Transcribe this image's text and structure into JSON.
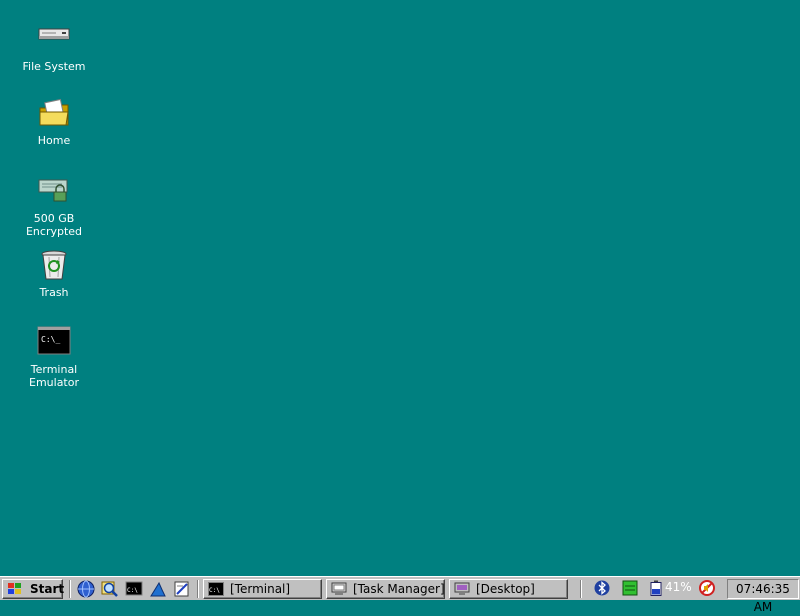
{
  "desktop": {
    "background": "#008080",
    "icons": [
      {
        "label": "File System",
        "icon": "drive-icon"
      },
      {
        "label": "Home",
        "icon": "folder-icon"
      },
      {
        "label": "500 GB\nEncrypted",
        "icon": "encrypted-drive-icon"
      },
      {
        "label": "Trash",
        "icon": "trash-icon"
      },
      {
        "label": "Terminal\nEmulator",
        "icon": "terminal-icon"
      }
    ]
  },
  "taskbar": {
    "start_label": "Start",
    "quick_launch": [
      "browser-icon",
      "search-icon",
      "terminal-icon",
      "shark-icon",
      "notepad-icon"
    ],
    "tasks": [
      {
        "label": "[Terminal]",
        "icon": "terminal-icon"
      },
      {
        "label": "[Task Manager]",
        "icon": "task-manager-icon"
      },
      {
        "label": "[Desktop]",
        "icon": "desktop-icon"
      }
    ],
    "tray": {
      "icons": [
        "bluetooth-icon",
        "network-icon",
        "battery-icon",
        "no-sound-icon"
      ],
      "battery_percent": "41%"
    },
    "clock": "07:46:35 AM"
  }
}
